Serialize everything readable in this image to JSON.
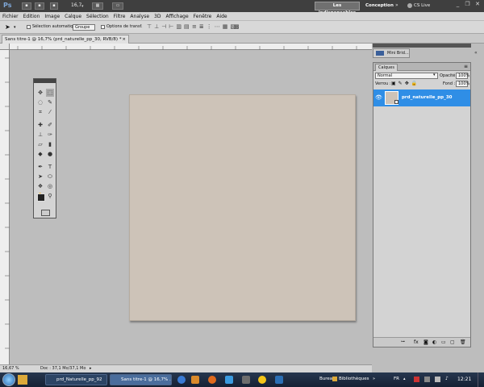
{
  "appbar": {
    "logo": "Ps",
    "zoom": "16,7",
    "workspace_active": "Les indispensables",
    "workspace_other": "Conception",
    "cs_live": "CS Live"
  },
  "menu": [
    "Fichier",
    "Edition",
    "Image",
    "Calque",
    "Sélection",
    "Filtre",
    "Analyse",
    "3D",
    "Affichage",
    "Fenêtre",
    "Aide"
  ],
  "options": {
    "auto_select_label": "Sélection automatique :",
    "auto_select_value": "Groupe",
    "transform_label": "Options de transf."
  },
  "document": {
    "tab_title": "Sans titre-1 @ 16,7% (prd_naturelle_pp_30, RVB/8) *",
    "canvas_color": "#cdc3b8"
  },
  "status": {
    "zoom": "16,67 %",
    "doc_info": "Doc : 37,1 Mo/37,1 Mo"
  },
  "minibridge": {
    "label": "Mini Brid..."
  },
  "layers_panel": {
    "tab": "Calques",
    "blend_mode": "Normal",
    "opacity_label": "Opacité :",
    "opacity_value": "100%",
    "lock_label": "Verrou :",
    "fill_label": "Fond :",
    "fill_value": "100%",
    "layer_name": "prd_naturelle_pp_30",
    "selected_color": "#2f8ee6"
  },
  "taskbar": {
    "task1": "prd_Naturelle_pp_92",
    "task2": "Sans titre-1 @ 16,7% ...",
    "bureau": "Bureau",
    "bibliotheques": "Bibliothèques",
    "lang": "FR",
    "time": "12:21"
  }
}
